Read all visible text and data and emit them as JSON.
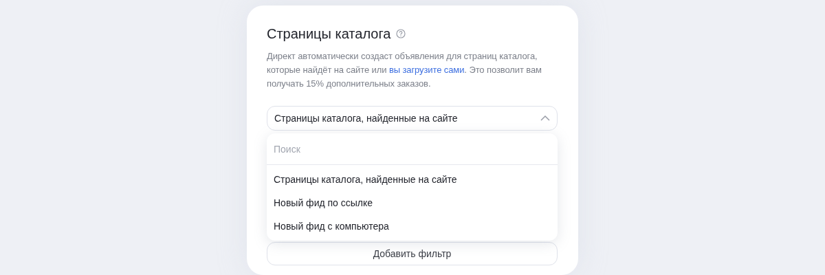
{
  "section": {
    "title": "Страницы каталога",
    "description": {
      "before": "Директ автоматически создаст объявления для страниц каталога, которые найдёт на сайте или ",
      "link": "вы загрузите сами",
      "after": ". Это позволит вам получать 15% дополнительных заказов."
    }
  },
  "select": {
    "value": "Страницы каталога, найденные на сайте",
    "expanded": true
  },
  "dropdown": {
    "search": {
      "placeholder": "Поиск"
    },
    "options": [
      {
        "label": "Страницы каталога, найденные на сайте"
      },
      {
        "label": "Новый фид по ссылке"
      },
      {
        "label": "Новый фид с компьютера"
      }
    ]
  },
  "add_filter_button": {
    "label": "Добавить фильтр"
  }
}
